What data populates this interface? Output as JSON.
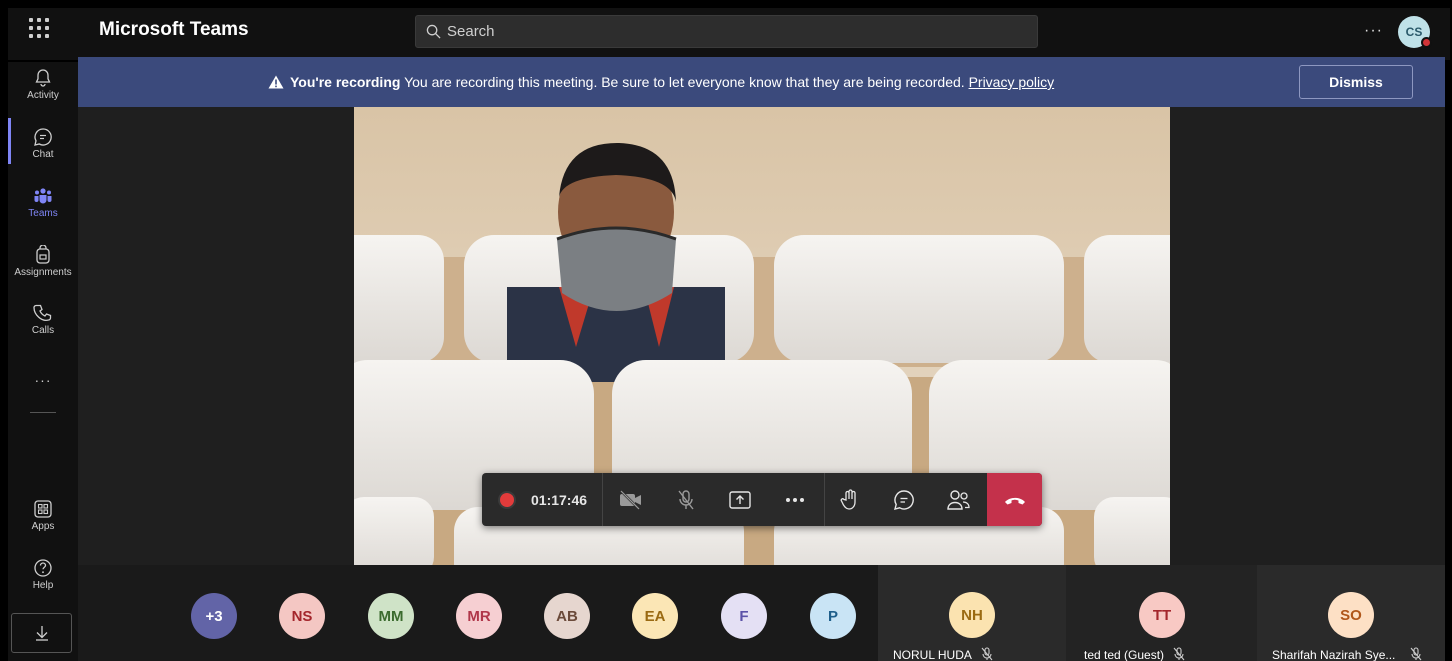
{
  "app": {
    "title": "Microsoft Teams"
  },
  "search": {
    "placeholder": "Search"
  },
  "user": {
    "initials": "CS"
  },
  "rail": {
    "items": [
      {
        "label": "Activity",
        "icon": "bell-icon"
      },
      {
        "label": "Chat",
        "icon": "chat-icon"
      },
      {
        "label": "Teams",
        "icon": "teams-icon",
        "active": true
      },
      {
        "label": "Assignments",
        "icon": "backpack-icon"
      },
      {
        "label": "Calls",
        "icon": "phone-icon"
      }
    ],
    "more": "···",
    "bottom": [
      {
        "label": "Apps",
        "icon": "apps-icon"
      },
      {
        "label": "Help",
        "icon": "help-icon"
      }
    ]
  },
  "banner": {
    "title": "You're recording",
    "message": "You are recording this meeting. Be sure to let everyone know that they are being recorded.",
    "link": "Privacy policy",
    "dismiss": "Dismiss"
  },
  "controls": {
    "timer": "01:17:46"
  },
  "participants": {
    "overflow": "+3",
    "avatars": [
      {
        "initials": "NS",
        "bg": "#f4c7c3",
        "fg": "#a4262c"
      },
      {
        "initials": "MM",
        "bg": "#cfe3c7",
        "fg": "#3b6b2e"
      },
      {
        "initials": "MR",
        "bg": "#f6cfd2",
        "fg": "#b0374a"
      },
      {
        "initials": "AB",
        "bg": "#e6d6cf",
        "fg": "#6b4a3a"
      },
      {
        "initials": "EA",
        "bg": "#fbe6b5",
        "fg": "#9a6a12"
      },
      {
        "initials": "F",
        "bg": "#e4e0f4",
        "fg": "#5b52a8"
      },
      {
        "initials": "P",
        "bg": "#c9e4f5",
        "fg": "#1f5f8b"
      }
    ],
    "tiles": [
      {
        "initials": "NH",
        "name": "NORUL HUDA",
        "bg": "#fbe3b0",
        "fg": "#9a6a12"
      },
      {
        "initials": "TT",
        "name": "ted ted (Guest)",
        "bg": "#f8c9c4",
        "fg": "#a4262c"
      },
      {
        "initials": "SO",
        "name": "Sharifah Nazirah Sye...",
        "bg": "#fde0c5",
        "fg": "#b0561a"
      }
    ]
  },
  "colors": {
    "accent": "#7f85f5",
    "banner": "#3b4a7c",
    "hangup": "#c4314b",
    "record": "#e23b3b"
  }
}
